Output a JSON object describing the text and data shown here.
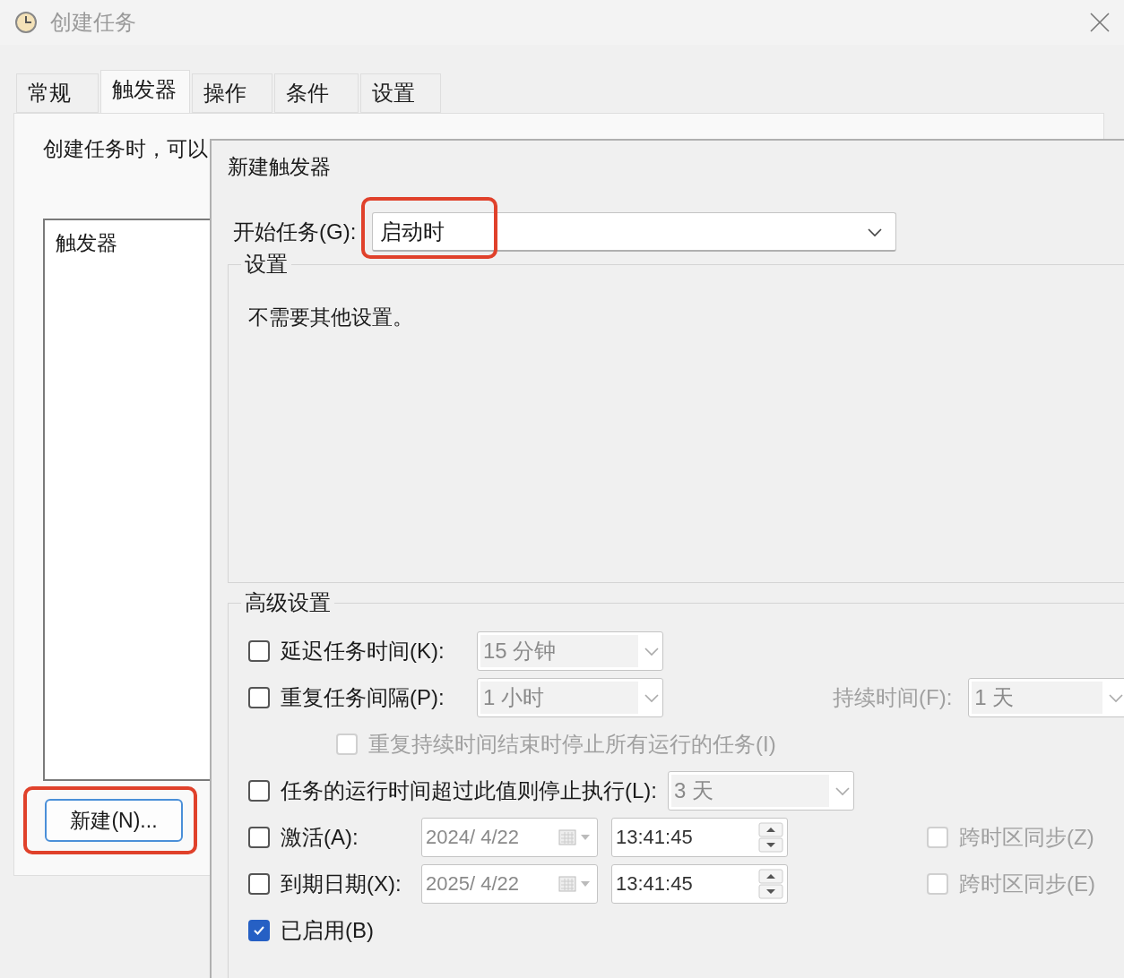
{
  "window": {
    "title": "创建任务"
  },
  "tabs": [
    {
      "label": "常规",
      "selected": false
    },
    {
      "label": "触发器",
      "selected": true
    },
    {
      "label": "操作",
      "selected": false
    },
    {
      "label": "条件",
      "selected": false
    },
    {
      "label": "设置",
      "selected": false
    }
  ],
  "description": "创建任务时，可以",
  "trigger_list": {
    "column": "触发器"
  },
  "new_button": {
    "label": "新建(N)...",
    "highlighted": true
  },
  "dialog": {
    "title": "新建触发器",
    "start_task": {
      "label": "开始任务(G):",
      "value": "启动时",
      "highlighted": true
    },
    "settings": {
      "legend": "设置",
      "text": "不需要其他设置。"
    },
    "advanced": {
      "legend": "高级设置",
      "rows": [
        {
          "kind": "combo",
          "label": "延迟任务时间(K):",
          "checked": false,
          "field": {
            "value": "15 分钟",
            "disabled": true
          }
        },
        {
          "kind": "combo",
          "label": "重复任务间隔(P):",
          "checked": false,
          "field": {
            "value": "1 小时",
            "disabled": true
          },
          "extra": {
            "label": "持续时间(F):",
            "value": "1 天",
            "disabled": true
          }
        },
        {
          "kind": "sub",
          "label": "重复持续时间结束时停止所有运行的任务(I)",
          "checked": false,
          "disabled": true
        },
        {
          "kind": "combo",
          "label": "任务的运行时间超过此值则停止执行(L):",
          "checked": false,
          "field": {
            "value": "3 天",
            "disabled": true
          }
        },
        {
          "kind": "datetime",
          "label": "激活(A):",
          "checked": false,
          "date": "2024/  4/22",
          "time": "13:41:45",
          "sync": {
            "label": "跨时区同步(Z)",
            "checked": false,
            "disabled": true
          }
        },
        {
          "kind": "datetime",
          "label": "到期日期(X):",
          "checked": false,
          "date": "2025/  4/22",
          "time": "13:41:45",
          "sync": {
            "label": "跨时区同步(E)",
            "checked": false,
            "disabled": true
          }
        },
        {
          "kind": "plain",
          "label": "已启用(B)",
          "checked": true
        }
      ]
    }
  }
}
